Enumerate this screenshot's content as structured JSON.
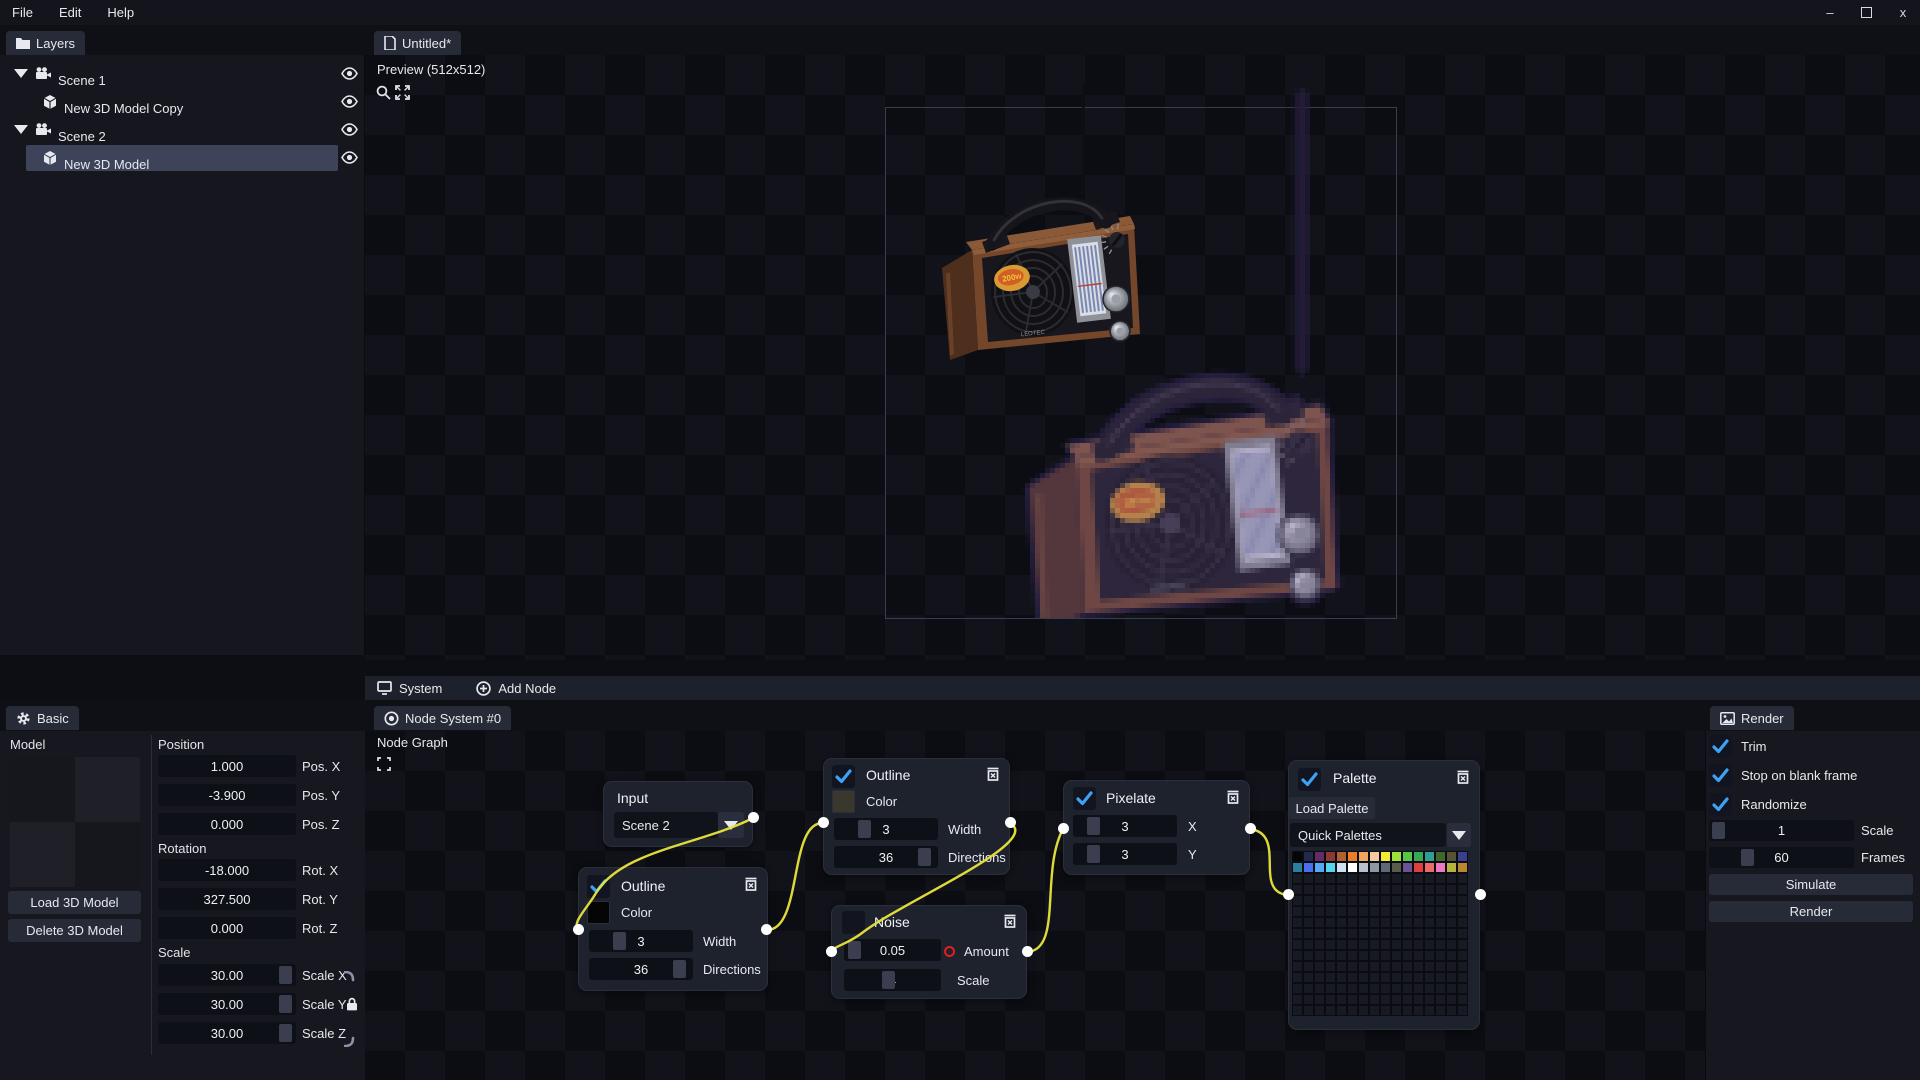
{
  "menu": {
    "items": [
      "File",
      "Edit",
      "Help"
    ],
    "window_controls": [
      "minimize",
      "maximize",
      "close"
    ]
  },
  "layers_panel": {
    "tab": "Layers",
    "items": [
      {
        "label": "Scene 1",
        "type": "scene",
        "visible": true,
        "selected": false
      },
      {
        "label": "New 3D Model Copy",
        "type": "model",
        "visible": true,
        "selected": false
      },
      {
        "label": "Scene 2",
        "type": "scene",
        "visible": true,
        "selected": false
      },
      {
        "label": "New 3D Model",
        "type": "model",
        "visible": true,
        "selected": true
      }
    ]
  },
  "document": {
    "tab": "Untitled*",
    "preview_label": "Preview (512x512)"
  },
  "system_bar": {
    "system": "System",
    "add_node": "Add Node"
  },
  "node_graph": {
    "tab": "Node System #0",
    "title": "Node Graph"
  },
  "nodes": {
    "input": {
      "title": "Input",
      "value": "Scene 2"
    },
    "outline1": {
      "title": "Outline",
      "checked": true,
      "color_label": "Color",
      "color": "#050505",
      "fields": [
        {
          "value": "3",
          "label": "Width"
        },
        {
          "value": "36",
          "label": "Directions"
        }
      ]
    },
    "outline2": {
      "title": "Outline",
      "checked": true,
      "color_label": "Color",
      "color": "#3a382c",
      "fields": [
        {
          "value": "3",
          "label": "Width"
        },
        {
          "value": "36",
          "label": "Directions"
        }
      ]
    },
    "noise": {
      "title": "Noise",
      "checked": false,
      "fields": [
        {
          "value": "0.05",
          "label": "Amount",
          "keyed": true
        },
        {
          "value": "4",
          "label": "Scale"
        }
      ]
    },
    "pixelate": {
      "title": "Pixelate",
      "checked": true,
      "fields": [
        {
          "value": "3",
          "label": "X"
        },
        {
          "value": "3",
          "label": "Y"
        }
      ]
    },
    "palette": {
      "title": "Palette",
      "checked": true,
      "load_button": "Load Palette",
      "dropdown": "Quick Palettes",
      "colors_row1": [
        "#050505",
        "#24284a",
        "#632c63",
        "#8c3a31",
        "#b05f2e",
        "#ea7e2a",
        "#f0a55f",
        "#f5c9a2",
        "#f8ea37",
        "#9fe13c",
        "#58c449",
        "#37a956",
        "#2f9e93",
        "#42672e",
        "#565433",
        "#3c3f8f"
      ],
      "colors_row2": [
        "#2a7f9e",
        "#4a6ef0",
        "#55a8f5",
        "#55d5f2",
        "#cfe0f2",
        "#ffffff",
        "#b8c2cf",
        "#8d97a6",
        "#5f6878",
        "#595b4d",
        "#6a5295",
        "#dd3f3f",
        "#ec6b66",
        "#ea79c1",
        "#b6b23f",
        "#b9872f"
      ]
    }
  },
  "basic_panel": {
    "tab": "Basic",
    "model_label": "Model",
    "buttons": {
      "load": "Load 3D Model",
      "delete": "Delete 3D Model"
    },
    "position": {
      "label": "Position",
      "fields": [
        {
          "value": "1.000",
          "label": "Pos. X"
        },
        {
          "value": "-3.900",
          "label": "Pos. Y"
        },
        {
          "value": "0.000",
          "label": "Pos. Z"
        }
      ]
    },
    "rotation": {
      "label": "Rotation",
      "fields": [
        {
          "value": "-18.000",
          "label": "Rot. X"
        },
        {
          "value": "327.500",
          "label": "Rot. Y"
        },
        {
          "value": "0.000",
          "label": "Rot. Z"
        }
      ]
    },
    "scale": {
      "label": "Scale",
      "linked_axis": "Scale Y",
      "fields": [
        {
          "value": "30.00",
          "label": "Scale X"
        },
        {
          "value": "30.00",
          "label": "Scale Y"
        },
        {
          "value": "30.00",
          "label": "Scale Z"
        }
      ]
    }
  },
  "render_panel": {
    "tab": "Render",
    "checkboxes": [
      {
        "label": "Trim",
        "checked": true
      },
      {
        "label": "Stop on blank frame",
        "checked": true
      },
      {
        "label": "Randomize",
        "checked": true
      }
    ],
    "fields": [
      {
        "value": "1",
        "label": "Scale"
      },
      {
        "value": "60",
        "label": "Frames"
      }
    ],
    "buttons": {
      "simulate": "Simulate",
      "render": "Render"
    }
  },
  "colors": {
    "accent_blue": "#3da1f5",
    "wire_yellow": "#e9e53c",
    "selection": "#3d4359",
    "keyframe_red": "#e01f1f"
  },
  "icons": [
    "folder-icon",
    "scene-camera-icon",
    "cube-icon",
    "eye-icon",
    "document-icon",
    "magnifier-icon",
    "expand-icon",
    "gear-icon",
    "monitor-icon",
    "add-circle-icon",
    "target-icon",
    "image-icon",
    "delete-node-icon",
    "lock-icon",
    "dropdown-arrow-icon",
    "check-icon"
  ]
}
